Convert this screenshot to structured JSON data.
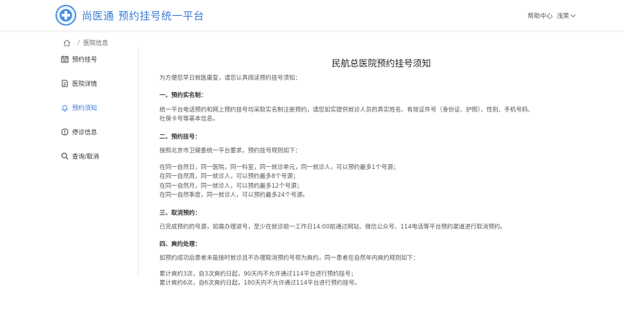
{
  "header": {
    "brand": "尚医通",
    "subtitle": "预约挂号统一平台",
    "help": "帮助中心",
    "user": "浅笑"
  },
  "breadcrumb": {
    "current": "医院信息"
  },
  "sidebar": {
    "items": [
      {
        "label": "预约挂号",
        "icon": "calendar-icon",
        "active": false
      },
      {
        "label": "医院详情",
        "icon": "document-icon",
        "active": false
      },
      {
        "label": "预约须知",
        "icon": "bell-icon",
        "active": true
      },
      {
        "label": "停诊信息",
        "icon": "info-icon",
        "active": false
      },
      {
        "label": "查询/取消",
        "icon": "search-icon",
        "active": false
      }
    ]
  },
  "content": {
    "title": "民航总医院预约挂号须知",
    "intro": "为方便您早日就医康复，请您认真阅读预约挂号须知：",
    "s1_title": "一、预约实名制：",
    "s1_line1": "统一平台电话预约和网上预约挂号均采取实名制注册预约，请您如实提供就诊人员的真实姓名、有效证件号（身份证、护照）、性别、手机号码、",
    "s1_line2": "社保卡号等基本信息。",
    "s2_title": "二、预约挂号：",
    "s2_intro": "按照北京市卫健委统一平台要求，预约挂号规则如下：",
    "s2_rule1": "在同一自然日，同一医院，同一科室，同一就诊单元，同一就诊人，可以预约最多1个号源；",
    "s2_rule2": "在同一自然周，同一就诊人，可以预约最多8个号源；",
    "s2_rule3": "在同一自然月，同一就诊人，可以预约最多12个号源；",
    "s2_rule4": "在同一自然季度，同一就诊人，可以预约最多24个号源。",
    "s3_title": "三、取消预约：",
    "s3_text": "已完成预约的号源，如需办理退号，至少在就诊前一工作日14:00前通过网站、微信公众号、114电话等平台预约渠道进行取消预约。",
    "s4_title": "四、爽约处理：",
    "s4_intro": "如预约成功后患者未能按时就诊且不办理取消预约号视为爽约，同一患者在自然年内爽约规则如下：",
    "s4_rule1": "累计爽约3次，自3次爽约日起，90天内不允许通过114平台进行预约挂号；",
    "s4_rule2": "累计爽约6次，自6次爽约日起，180天内不允许通过114平台进行预约挂号。"
  },
  "colors": {
    "accent": "#3a7bd5",
    "text": "#333333",
    "muted": "#555555"
  }
}
